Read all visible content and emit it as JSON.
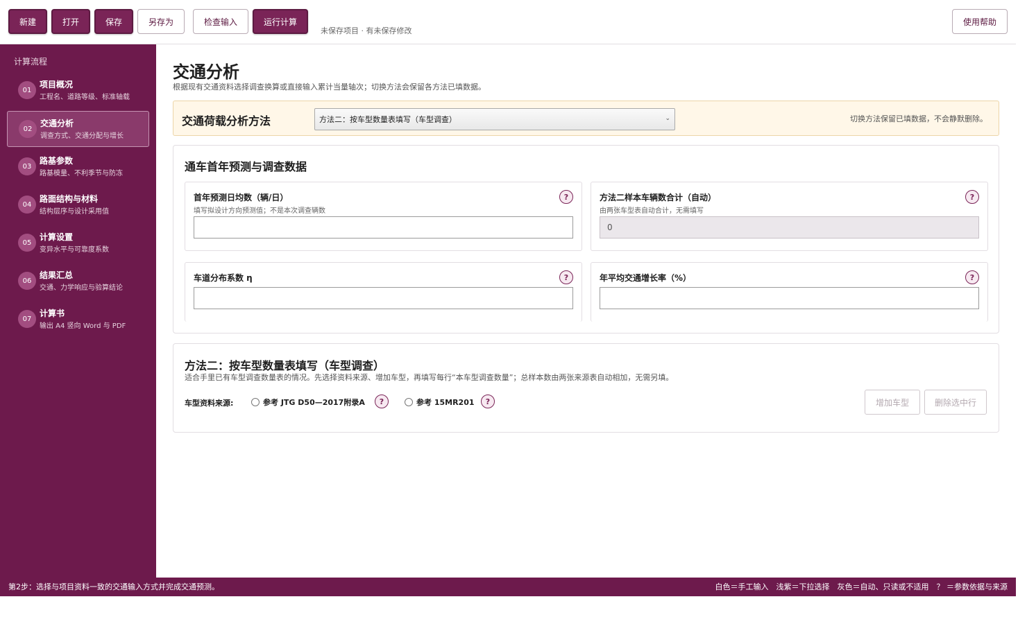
{
  "toolbar": {
    "new_label": "新建",
    "open_label": "打开",
    "save_label": "保存",
    "save_as_label": "另存为",
    "check_label": "检查输入",
    "run_label": "运行计算",
    "status": "未保存项目 · 有未保存修改",
    "help_label": "使用帮助"
  },
  "sidebar": {
    "heading": "计算流程",
    "steps": [
      {
        "num": "01",
        "title": "项目概况",
        "sub": "工程名、道路等级、标准轴载"
      },
      {
        "num": "02",
        "title": "交通分析",
        "sub": "调查方式、交通分配与增长"
      },
      {
        "num": "03",
        "title": "路基参数",
        "sub": "路基模量、不利季节与防冻"
      },
      {
        "num": "04",
        "title": "路面结构与材料",
        "sub": "结构层序与设计采用值"
      },
      {
        "num": "05",
        "title": "计算设置",
        "sub": "变异水平与可靠度系数"
      },
      {
        "num": "06",
        "title": "结果汇总",
        "sub": "交通、力学响应与验算结论"
      },
      {
        "num": "07",
        "title": "计算书",
        "sub": "输出 A4 竖向 Word 与 PDF"
      }
    ]
  },
  "main": {
    "title": "交通分析",
    "description": "根据现有交通资料选择调查换算或直接输入累计当量轴次；切换方法会保留各方法已填数据。",
    "method": {
      "label": "交通荷载分析方法",
      "selected": "方法二：按车型数量表填写（车型调查）",
      "note": "切换方法保留已填数据，不会静默删除。"
    },
    "survey_card": {
      "title": "通车首年预测与调查数据",
      "fields": {
        "daily_volume": {
          "label": "首年预测日均数（辆/日）",
          "hint": "填写拟设计方向预测值；不是本次调查辆数",
          "value": ""
        },
        "sample_total": {
          "label": "方法二样本车辆数合计（自动）",
          "hint": "由两张车型表自动合计，无需填写",
          "value": "0"
        },
        "lane_factor": {
          "label": "车道分布系数 η",
          "value": ""
        },
        "growth_rate": {
          "label": "年平均交通增长率（%）",
          "value": ""
        }
      }
    },
    "method2_card": {
      "title": "方法二：按车型数量表填写（车型调查）",
      "description": "适合手里已有车型调查数量表的情况。先选择资料来源、增加车型，再填写每行“本车型调查数量”；总样本数由两张来源表自动相加，无需另填。",
      "source_label": "车型资料来源:",
      "source_options": [
        "参考 JTG D50—2017附录A",
        "参考 15MR201"
      ],
      "add_label": "增加车型",
      "delete_label": "删除选中行"
    }
  },
  "help_glyph": "?",
  "status_bar": {
    "text": "第2步：选择与项目资料一致的交通输入方式并完成交通预测。",
    "legend": [
      "白色＝手工输入",
      "浅紫＝下拉选择",
      "灰色＝自动、只读或不适用",
      "？ ＝参数依据与来源"
    ]
  },
  "colors": {
    "brand": "#6d1a4c",
    "button": "#7a2457",
    "method_panel_bg": "#fff7e8",
    "auto_field_bg": "#ebe7eb"
  }
}
